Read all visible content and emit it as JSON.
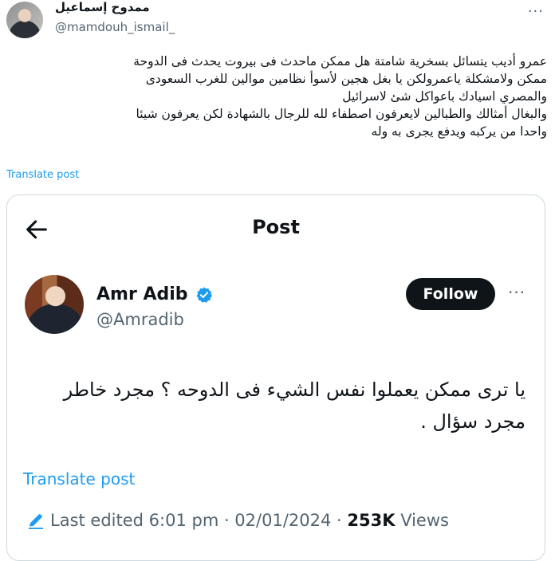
{
  "author": {
    "name": "ممدوح إسماعيل",
    "handle": "@mamdouh_ismail_"
  },
  "more_label": "···",
  "tweet_lines": [
    "عمرو أديب يتسائل بسخرية شامتة هل ممكن ماحدث فى بيروت يحدث فى الدوحة",
    "ممكن ولامشكلة ياعمرولكن يا بغل هجين لأسوأ نظامين موالين للغرب السعودى",
    "والمصري اسيادك باعواكل شئ لاسرائيل",
    "والبغال أمثالك والطبالين لايعرفون اصطفاء لله للرجال بالشهادة لكن يعرفون شيئا",
    "واحدا من يركبه ويدفع يجرى به وله"
  ],
  "translate_small": "Translate post",
  "quote": {
    "header_title": "Post",
    "name": "Amr Adib",
    "handle": "@Amradib",
    "follow_label": "Follow",
    "text_lines": [
      "يا ترى ممكن يعملوا نفس الشيء فى الدوحه ؟ مجرد خاطر",
      "مجرد سؤال ."
    ],
    "translate_label": "Translate post",
    "edited": "Last edited 6:01 pm · 02/01/2024 ·",
    "views_count": "253K",
    "views_label": "Views"
  },
  "colors": {
    "link": "#1d9bf0",
    "verified": "#1d9bf0",
    "muted": "#536471",
    "border": "#cfd9de"
  }
}
